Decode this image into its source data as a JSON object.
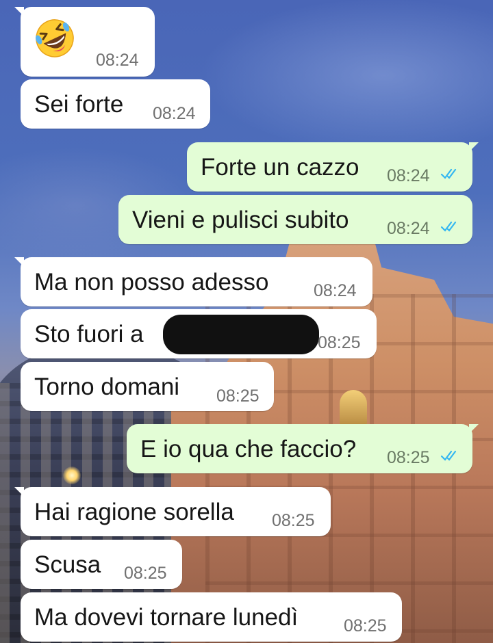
{
  "conversation": {
    "messages": [
      {
        "direction": "incoming",
        "emoji": "rolling-on-the-floor-laughing",
        "time": "08:24"
      },
      {
        "direction": "incoming",
        "text": "Sei forte",
        "time": "08:24"
      },
      {
        "direction": "outgoing",
        "text": "Forte un cazzo",
        "time": "08:24",
        "status": "read"
      },
      {
        "direction": "outgoing",
        "text": "Vieni e pulisci subito",
        "time": "08:24",
        "status": "read"
      },
      {
        "direction": "incoming",
        "text": "Ma non posso adesso",
        "time": "08:24"
      },
      {
        "direction": "incoming",
        "text": "Sto fuori a",
        "time": "08:25",
        "redacted": true
      },
      {
        "direction": "incoming",
        "text": "Torno domani",
        "time": "08:25"
      },
      {
        "direction": "outgoing",
        "text": "E io qua che faccio?",
        "time": "08:25",
        "status": "read"
      },
      {
        "direction": "incoming",
        "text": "Hai ragione sorella",
        "time": "08:25"
      },
      {
        "direction": "incoming",
        "text": "Scusa",
        "time": "08:25"
      },
      {
        "direction": "incoming",
        "text": "Ma dovevi tornare lunedì",
        "time": "08:25"
      }
    ]
  },
  "colors": {
    "incoming_bubble": "#ffffff",
    "outgoing_bubble": "#e3fdd6",
    "read_ticks": "#34b7f1"
  }
}
